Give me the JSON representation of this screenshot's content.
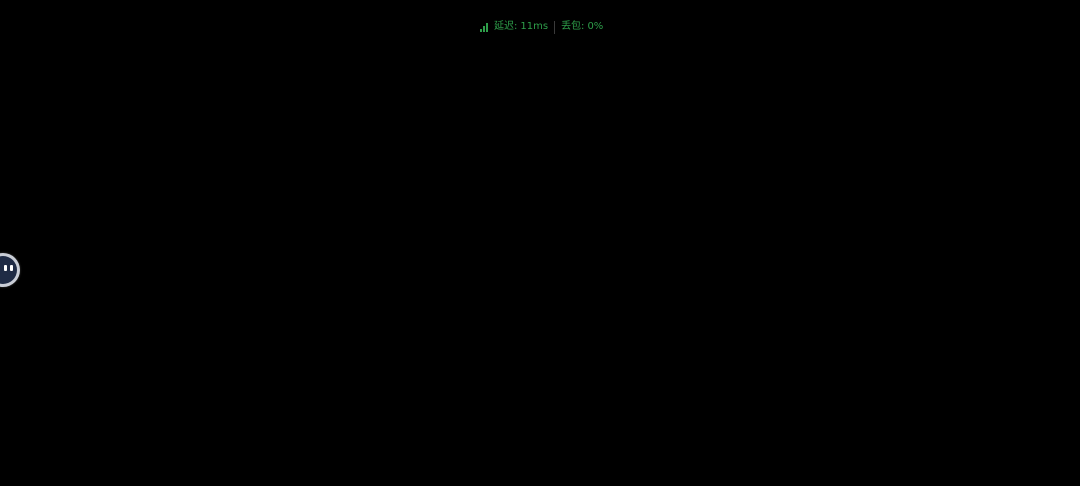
{
  "network_overlay": {
    "icon": "signal-bars-icon",
    "latency_label": "延迟:",
    "latency_value": "11ms",
    "packet_loss_label": "丢包:",
    "packet_loss_value": "0%",
    "text_color": "#2e9e4a"
  },
  "floating_ball": {
    "icon": "floating-assistant-icon"
  },
  "colors": {
    "background": "#000000"
  }
}
